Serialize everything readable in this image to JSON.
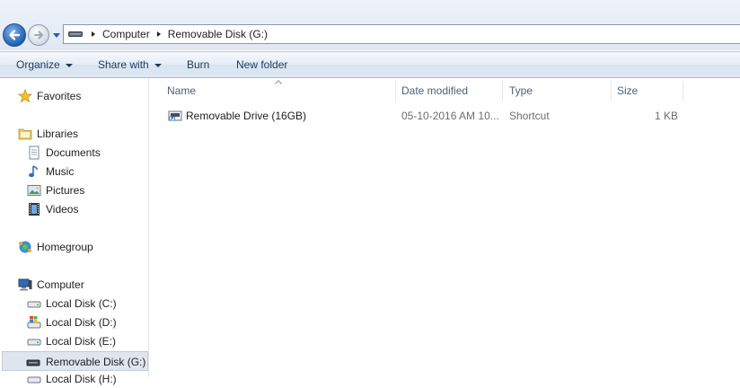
{
  "address": {
    "breadcrumbs": [
      "Computer",
      "Removable Disk (G:)"
    ]
  },
  "toolbar": {
    "organize_label": "Organize",
    "share_label": "Share with",
    "burn_label": "Burn",
    "new_folder_label": "New folder"
  },
  "nav": {
    "favorites": "Favorites",
    "libraries": "Libraries",
    "documents": "Documents",
    "music": "Music",
    "pictures": "Pictures",
    "videos": "Videos",
    "homegroup": "Homegroup",
    "computer": "Computer",
    "local_c": "Local Disk (C:)",
    "local_d": "Local Disk (D:)",
    "local_e": "Local Disk (E:)",
    "removable_g": "Removable Disk (G:)",
    "partial_next": "Local Disk (H:)"
  },
  "columns": {
    "name": "Name",
    "date_modified": "Date modified",
    "type": "Type",
    "size": "Size"
  },
  "files": [
    {
      "name": "Removable Drive (16GB)",
      "date_modified": "05-10-2016 AM 10...",
      "type": "Shortcut",
      "size": "1 KB",
      "icon": "shortcut-drive-icon"
    }
  ],
  "colors": {
    "command_text": "#1e395b",
    "header_text": "#4c607a",
    "muted_text": "#6d6d6d",
    "selected_bg": "#dfe6ef"
  }
}
